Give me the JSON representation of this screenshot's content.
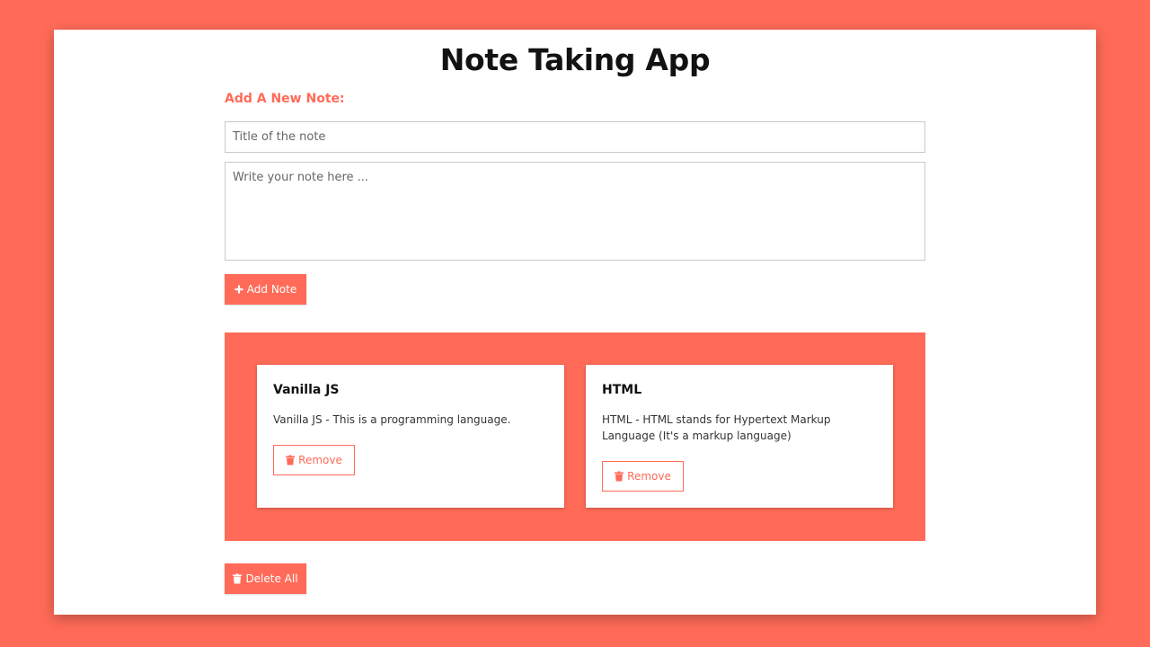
{
  "app": {
    "title": "Note Taking App"
  },
  "form": {
    "section_label": "Add A New Note:",
    "title_placeholder": "Title of the note",
    "body_placeholder": "Write your note here ...",
    "add_button_label": "Add Note",
    "add_button_icon": "plus-icon"
  },
  "notes": [
    {
      "title": "Vanilla JS",
      "text": "Vanilla JS - This is a programming language.",
      "remove_label": "Remove",
      "remove_icon": "trash-icon"
    },
    {
      "title": "HTML",
      "text": "HTML - HTML stands for Hypertext Markup Language (It's a markup language)",
      "remove_label": "Remove",
      "remove_icon": "trash-icon"
    }
  ],
  "footer": {
    "delete_all_label": "Delete All",
    "delete_all_icon": "trash-icon"
  },
  "colors": {
    "accent": "#ff6b58",
    "card": "#ffffff",
    "title_text": "#121212"
  }
}
